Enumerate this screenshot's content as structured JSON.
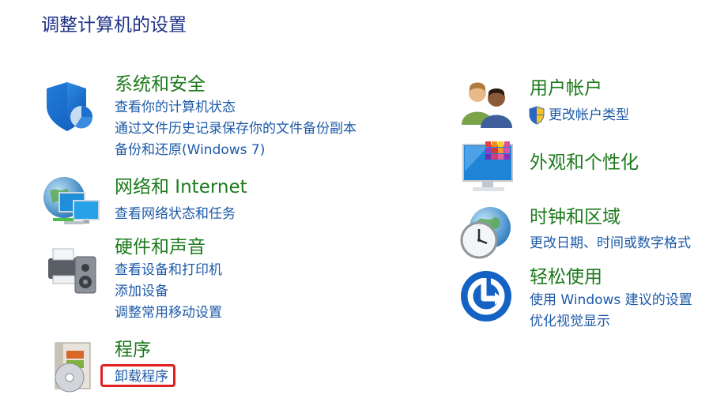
{
  "page": {
    "title": "调整计算机的设置"
  },
  "categories": {
    "system_security": {
      "title": "系统和安全",
      "icon": "security-shield-icon",
      "links": [
        "查看你的计算机状态",
        "通过文件历史记录保存你的文件备份副本",
        "备份和还原(Windows 7)"
      ]
    },
    "network": {
      "title": "网络和 Internet",
      "icon": "network-globe-icon",
      "links": [
        "查看网络状态和任务"
      ]
    },
    "hardware": {
      "title": "硬件和声音",
      "icon": "printer-speaker-icon",
      "links": [
        "查看设备和打印机",
        "添加设备",
        "调整常用移动设置"
      ]
    },
    "programs": {
      "title": "程序",
      "icon": "programs-disc-icon",
      "links": [
        "卸载程序"
      ]
    },
    "user_accounts": {
      "title": "用户帐户",
      "icon": "users-icon",
      "links": [
        "更改帐户类型"
      ]
    },
    "appearance": {
      "title": "外观和个性化",
      "icon": "monitor-palette-icon",
      "links": []
    },
    "clock_region": {
      "title": "时钟和区域",
      "icon": "clock-globe-icon",
      "links": [
        "更改日期、时间或数字格式"
      ]
    },
    "ease_access": {
      "title": "轻松使用",
      "icon": "ease-of-access-icon",
      "links": [
        "使用 Windows 建议的设置",
        "优化视觉显示"
      ]
    }
  },
  "colors": {
    "title_blue": "#1e3287",
    "category_green": "#1c7a1c",
    "link_blue": "#1d5aa8",
    "highlight_red": "#e02020"
  }
}
